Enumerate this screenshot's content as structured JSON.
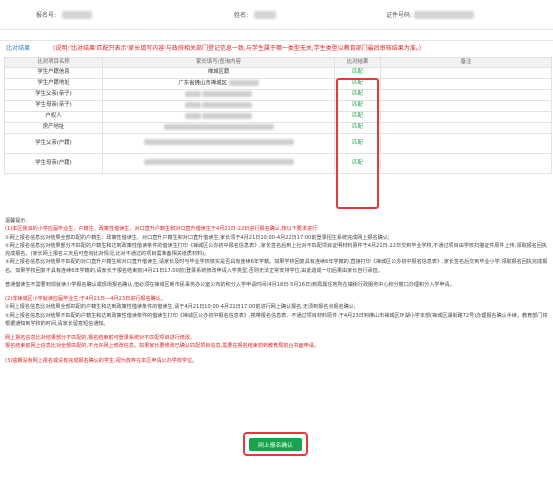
{
  "info": {
    "reg_no_label": "报名号:",
    "name_label": "姓名:",
    "id_label": "证件号码:"
  },
  "result": {
    "title": "比对结果",
    "note": "(说明:'比对结果'匹配只表示'家长填写内容'与政府相关部门登记信息一致,与学生属于哪一类型无关,学生类型以教育部门最后审核结果为准。)"
  },
  "table": {
    "headers": [
      "比对项目名称",
      "家长填写/查询内容",
      "比对结果",
      "备注"
    ],
    "rows": [
      {
        "name": "学生户籍信息",
        "value": "禅城区籍",
        "result": "匹配"
      },
      {
        "name": "学生户籍地址",
        "value": "广东省佛山市禅城区",
        "result": "匹配"
      },
      {
        "name": "学生父亲(亲子)",
        "value": "",
        "result": "匹配"
      },
      {
        "name": "学生母亲(亲子)",
        "value": "",
        "result": "匹配"
      },
      {
        "name": "户权人",
        "value": "",
        "result": "匹配"
      },
      {
        "name": "房产地址",
        "value": "",
        "result": "匹配"
      },
      {
        "name": "学生父亲(户籍)",
        "value": "",
        "result": "匹配"
      },
      {
        "name": "学生母亲(户籍)",
        "value": "",
        "result": "匹配"
      }
    ]
  },
  "notes": {
    "head": "温馨提示:",
    "s1_title": "(1)本区我派的小学应届毕业生、户籍生、政策性借读生、对口直升户籍生和对口直升借读生于4月21日-22日进行报名确认,按以下要求进行:",
    "s1_p1": "①网上报名信息比对结果全部匹配的户籍生、政策性借读生、对口直升户籍生和对口直升借读生,家长须于4月21日10:00-4月22日17:00前登录招生系统完成网上报名确认;",
    "s1_p2": "②网上报名信息比对结果部分不匹配的户籍生和达到政策性借读条件的借读生打印《禅城区公办初中报名信息表》,家长签名后到上社对不匹配项目证明材料原件于4月21日-22日交到毕业学校,不通过项目由学校扫描证件原件上传,领取报名回执完成报名。(家长网上报名三天后可查询比对情况,比对不通过的项目需准备相关纸质材料)。",
    "s1_p3": "③网上报名信息比对结果不匹配的对口直升户籍生和对口直升借读生,请家长及时与毕业学校核实是否具有连续6年学籍。如果学校回复具有连续6年学籍的,直接打印《禅城区公办初中报名信息表》,家长签名后交到毕业小学,领取报名回执完成报名。如果学校回复不具有连续6年学籍的,请家长于报名结束前(4月21日17:00前)登录系统修改申请入学类型,否则无法正常安排学位,由此造成一切后果由家长自行承担。",
    "s2": "普通借读生不需要到现就读小学报名确认或现场报名确认,但必须在禅城区新市民事务办公室公布的积分入学申请时间(4月18日-5月16日)到局属住地所在镇街行政服务中心积分窗口办理积分入学申请。",
    "s3_title": "(2)非禅城区小学就读应届毕业生:于4月21日—4月23日进行报名确认。",
    "s3_p1": "①网上报名信息比对结果全部匹配的户籍生和达到政策性借读条件的借读生,请于4月21日10:00-4月22日17:00前进行网上确认报名,无须到报名点报名确认;",
    "s3_p2": "②网上报名信息比对结果不匹配的户籍生和达到政策性借读条件的借读生打印《禅城区公办初中报名信息表》,携带报名信息表、不通过项目材料原件,于4月23日到佛山市禅城区环湖小学本部(禅城区湖街路72号)办理报名确认手续。教育部门将根据通知到学校的时间,请家长留意短信通知。",
    "r1": "网上报名信息比对结果部分不匹配的,报名结束前可登录系统对不匹配项目进行修改。",
    "r2": "报名结束前网上信息比对全部匹配的,不允许网上修改信息。如果家长要修改已确认匹配项目信息,需要在报名结束前到教育局前台书面申请。",
    "s4": "(3)逾期没有网上报名或没有完成报名确认的学生,视为放弃在本区申请公办学校学位。"
  },
  "submit_label": "网上报名确认"
}
